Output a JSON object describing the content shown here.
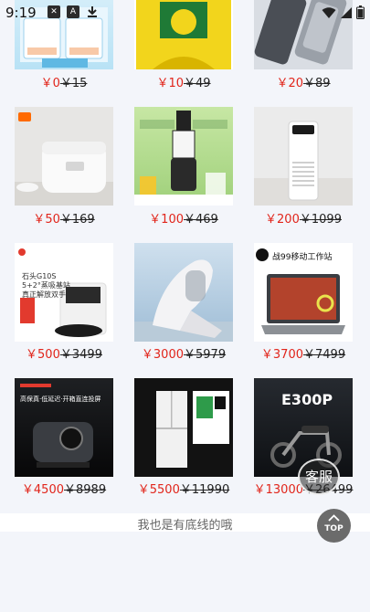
{
  "status_bar": {
    "time": "9:19",
    "left_icons": [
      "close-box-icon",
      "font-a-icon",
      "download-icon"
    ],
    "right_icons": [
      "wifi-icon",
      "signal-icon",
      "battery-icon"
    ]
  },
  "currency": "￥",
  "products": [
    {
      "name": "facial-tissue",
      "price": "0",
      "original": "15"
    },
    {
      "name": "rice-bag",
      "price": "10",
      "original": "49"
    },
    {
      "name": "power-bank",
      "price": "20",
      "original": "89"
    },
    {
      "name": "rice-cooker",
      "price": "50",
      "original": "169"
    },
    {
      "name": "juicer",
      "price": "100",
      "original": "469"
    },
    {
      "name": "air-purifier",
      "price": "200",
      "original": "1099"
    },
    {
      "name": "robot-vacuum",
      "price": "500",
      "original": "3499",
      "image_text": [
        "石头G10S",
        "5+2°蒸吸基站",
        "真正解放双手"
      ]
    },
    {
      "name": "massage-chair",
      "price": "3000",
      "original": "5979"
    },
    {
      "name": "laptop",
      "price": "3700",
      "original": "7499",
      "image_text": [
        "战99移动工作站"
      ]
    },
    {
      "name": "projector",
      "price": "4500",
      "original": "8989",
      "image_text": [
        "高保真·低延迟·开箱直连投屏"
      ]
    },
    {
      "name": "refrigerator",
      "price": "5500",
      "original": "11990"
    },
    {
      "name": "electric-scooter",
      "price": "13000",
      "original": "26499",
      "image_text": [
        "E300P"
      ]
    }
  ],
  "footer": {
    "text": "我也是有底线的哦"
  },
  "top_button": {
    "label": "TOP"
  },
  "floating_badge": {
    "text": "客服"
  },
  "colors": {
    "price_red": "#e1251b",
    "background": "#f3f5fa"
  }
}
